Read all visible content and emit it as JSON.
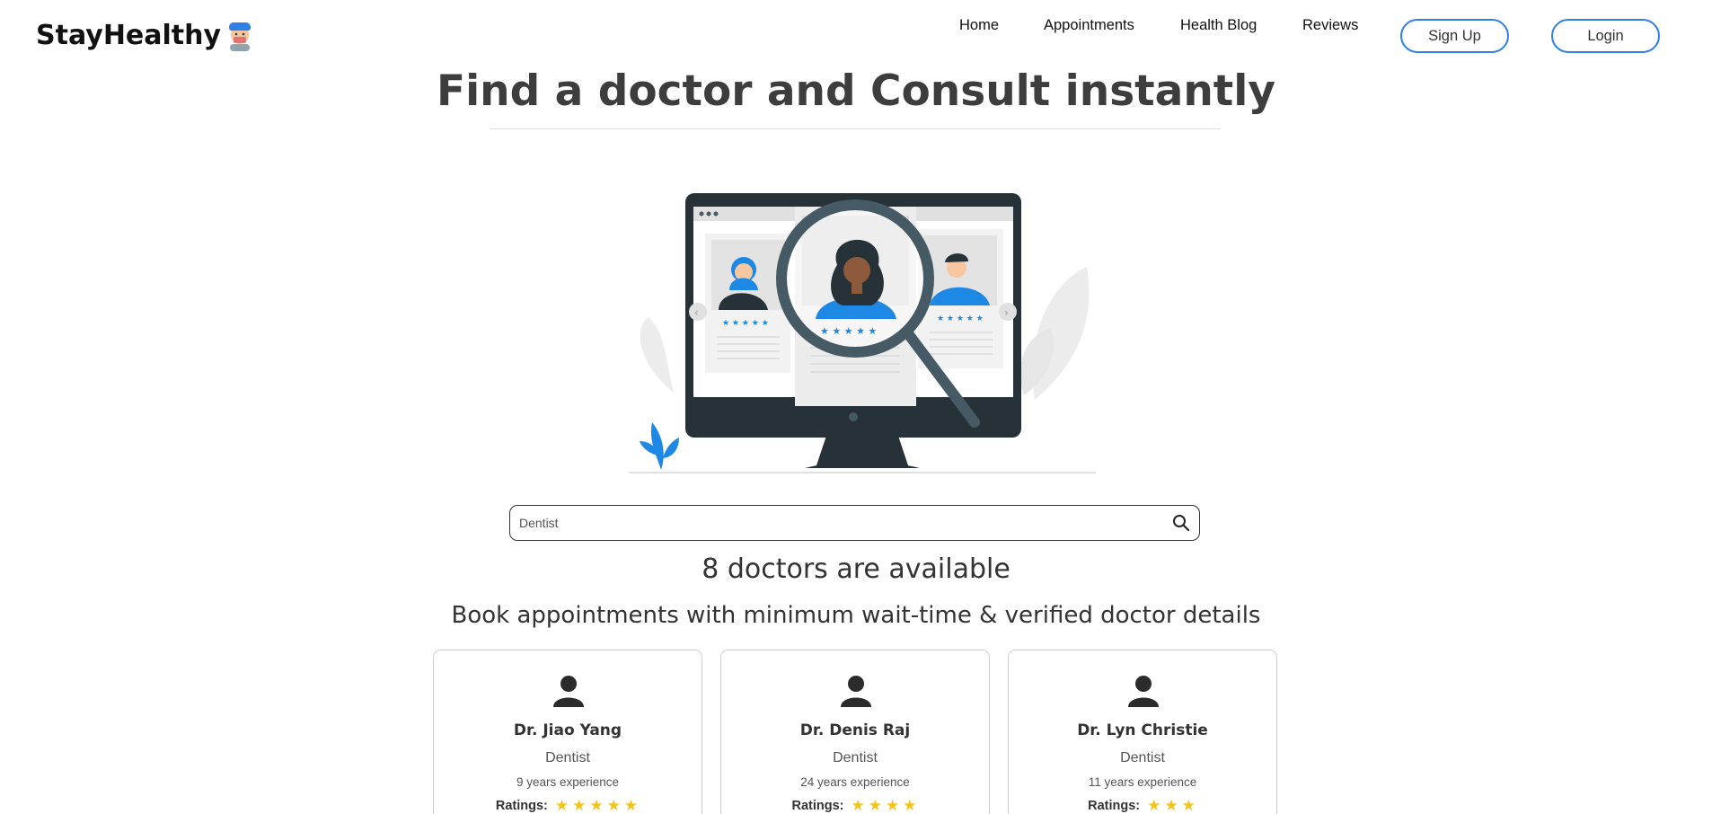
{
  "brand": {
    "name": "StayHealthy",
    "icon": "doctor-face-icon"
  },
  "nav": {
    "home": "Home",
    "appointments": "Appointments",
    "blog": "Health Blog",
    "reviews": "Reviews",
    "signup": "Sign Up",
    "login": "Login"
  },
  "hero": {
    "title": "Find a doctor and Consult instantly"
  },
  "search": {
    "value": "Dentist",
    "icon": "search-icon"
  },
  "results": {
    "count_text": "8 doctors are available",
    "subtitle": "Book appointments with minimum wait-time & verified doctor details"
  },
  "doctors": [
    {
      "name": "Dr. Jiao Yang",
      "specialty": "Dentist",
      "experience": "9 years experience",
      "ratings_label": "Ratings:",
      "stars": 5
    },
    {
      "name": "Dr. Denis Raj",
      "specialty": "Dentist",
      "experience": "24 years experience",
      "ratings_label": "Ratings:",
      "stars": 4
    },
    {
      "name": "Dr. Lyn Christie",
      "specialty": "Dentist",
      "experience": "11 years experience",
      "ratings_label": "Ratings:",
      "stars": 3
    }
  ],
  "colors": {
    "accent": "#2f80e5",
    "star": "#f7c21b",
    "monitor": "#263238",
    "illustration_blue": "#1e88e5"
  }
}
